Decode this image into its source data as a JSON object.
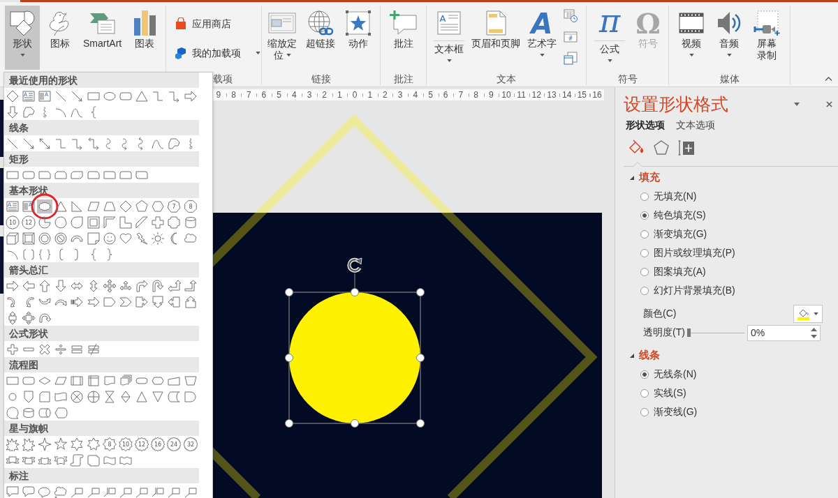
{
  "ribbon": {
    "groups": [
      {
        "buttons": [
          {
            "label": "形状",
            "kind": "large",
            "dropdown": true,
            "expanded": true,
            "disabled": false
          },
          {
            "label": "图标",
            "kind": "large",
            "dropdown": false,
            "expanded": false,
            "disabled": false
          },
          {
            "label": "SmartArt",
            "kind": "large",
            "dropdown": false,
            "expanded": false,
            "disabled": false
          },
          {
            "label": "图表",
            "kind": "large",
            "dropdown": false,
            "expanded": false,
            "disabled": false
          }
        ]
      },
      {
        "label": "载项",
        "buttons": [
          {
            "label": "应用商店",
            "kind": "row",
            "dropdown": false,
            "expanded": false,
            "disabled": false
          },
          {
            "label": "我的加载项",
            "kind": "row",
            "dropdown": true,
            "expanded": false,
            "disabled": false
          }
        ]
      },
      {
        "label": "链接",
        "buttons": [
          {
            "label": "缩放定位",
            "kind": "tall",
            "dropdown": true,
            "expanded": false,
            "disabled": false
          },
          {
            "label": "超链接",
            "kind": "large",
            "dropdown": false,
            "expanded": false,
            "disabled": false
          },
          {
            "label": "动作",
            "kind": "large",
            "dropdown": false,
            "expanded": false,
            "disabled": false
          }
        ]
      },
      {
        "label": "批注",
        "buttons": [
          {
            "label": "批注",
            "kind": "large",
            "dropdown": false,
            "expanded": false,
            "disabled": false
          }
        ]
      },
      {
        "label": "文本",
        "buttons": [
          {
            "label": "文本框",
            "kind": "split",
            "glyph": "A",
            "dropdown": true,
            "expanded": false,
            "disabled": false
          },
          {
            "label": "页眉和页脚",
            "kind": "large",
            "dropdown": false,
            "expanded": false,
            "disabled": false
          },
          {
            "label": "艺术字",
            "kind": "large",
            "glyph": "A",
            "dropdown": true,
            "expanded": false,
            "disabled": false
          },
          {
            "kind": "small",
            "dropdown": false,
            "expanded": false,
            "disabled": false
          },
          {
            "kind": "small",
            "glyph": "#",
            "dropdown": false,
            "expanded": false,
            "disabled": false
          },
          {
            "kind": "small",
            "dropdown": false,
            "expanded": false,
            "disabled": false
          }
        ]
      },
      {
        "label": "符号",
        "buttons": [
          {
            "label": "公式",
            "kind": "split",
            "glyph": "π",
            "dropdown": true,
            "expanded": false,
            "disabled": false
          },
          {
            "label": "符号",
            "kind": "large",
            "glyph": "Ω",
            "dropdown": false,
            "expanded": false,
            "disabled": true
          }
        ]
      },
      {
        "label": "媒体",
        "buttons": [
          {
            "label": "视频",
            "kind": "large",
            "dropdown": true,
            "expanded": false,
            "disabled": false
          },
          {
            "label": "音频",
            "kind": "large",
            "dropdown": true,
            "expanded": false,
            "disabled": false
          },
          {
            "label": "屏幕录制",
            "kind": "tall",
            "dropdown": false,
            "expanded": false,
            "disabled": false
          }
        ]
      }
    ]
  },
  "shapes_gallery": {
    "sections": [
      {
        "heading": "最近使用的形状",
        "items": [
          {
            "kind": "diamond",
            "selected": false
          },
          {
            "kind": "textbox",
            "label": "A",
            "selected": false
          },
          {
            "kind": "vtextbox",
            "label": "A",
            "selected": false
          },
          {
            "kind": "line",
            "selected": false
          },
          {
            "kind": "linearrow",
            "selected": false
          },
          {
            "kind": "rect",
            "selected": false
          },
          {
            "kind": "oval",
            "selected": false
          },
          {
            "kind": "roundrect",
            "selected": false
          },
          {
            "kind": "triangle",
            "selected": false
          },
          {
            "kind": "elbow",
            "selected": false
          },
          {
            "kind": "elbowarrow",
            "selected": false
          },
          {
            "kind": "rightarrow",
            "selected": false
          },
          {
            "kind": "downarrow",
            "selected": false
          },
          {
            "kind": "freeform",
            "selected": false
          },
          {
            "kind": "scribble",
            "selected": false
          },
          {
            "kind": "arc",
            "selected": false
          },
          {
            "kind": "curve",
            "selected": false
          },
          {
            "kind": "leftbrace",
            "selected": false
          }
        ]
      },
      {
        "heading": "线条",
        "items": [
          {
            "kind": "line",
            "selected": false
          },
          {
            "kind": "linearrow",
            "selected": false
          },
          {
            "kind": "dblarrow",
            "selected": false
          },
          {
            "kind": "elbow",
            "selected": false
          },
          {
            "kind": "elbowarrow",
            "selected": false
          },
          {
            "kind": "elbowdbl",
            "selected": false
          },
          {
            "kind": "curved",
            "selected": false
          },
          {
            "kind": "curvedarrow",
            "selected": false
          },
          {
            "kind": "curveddbl",
            "selected": false
          },
          {
            "kind": "curve",
            "selected": false
          },
          {
            "kind": "freeform",
            "selected": false
          },
          {
            "kind": "scribble",
            "selected": false
          }
        ]
      },
      {
        "heading": "矩形",
        "items": [
          {
            "kind": "rect",
            "selected": false
          },
          {
            "kind": "roundrect",
            "selected": false
          },
          {
            "kind": "snip1",
            "selected": false
          },
          {
            "kind": "snip2same",
            "selected": false
          },
          {
            "kind": "snip2diag",
            "selected": false
          },
          {
            "kind": "snipround",
            "selected": false
          },
          {
            "kind": "round1",
            "selected": false
          },
          {
            "kind": "round2same",
            "selected": false
          },
          {
            "kind": "round2diag",
            "selected": false
          }
        ]
      },
      {
        "heading": "基本形状",
        "items": [
          {
            "kind": "textbox",
            "label": "A",
            "selected": false
          },
          {
            "kind": "vtextbox",
            "label": "A",
            "selected": false
          },
          {
            "kind": "oval",
            "selected": true
          },
          {
            "kind": "triangle",
            "selected": false
          },
          {
            "kind": "rtriangle",
            "selected": false
          },
          {
            "kind": "parallelogram",
            "selected": false
          },
          {
            "kind": "trapezoid",
            "selected": false
          },
          {
            "kind": "diamond",
            "selected": false
          },
          {
            "kind": "pentagon",
            "selected": false
          },
          {
            "kind": "hexagon",
            "selected": false
          },
          {
            "kind": "heptagon",
            "label": "7",
            "selected": false
          },
          {
            "kind": "octagon",
            "label": "8",
            "selected": false
          },
          {
            "kind": "decagon",
            "label": "10",
            "selected": false
          },
          {
            "kind": "dodecagon",
            "label": "12",
            "selected": false
          },
          {
            "kind": "pie",
            "selected": false
          },
          {
            "kind": "chord",
            "selected": false
          },
          {
            "kind": "teardrop",
            "selected": false
          },
          {
            "kind": "frame",
            "selected": false
          },
          {
            "kind": "halfframe",
            "selected": false
          },
          {
            "kind": "lshape",
            "selected": false
          },
          {
            "kind": "diagstripe",
            "selected": false
          },
          {
            "kind": "cross",
            "selected": false
          },
          {
            "kind": "plaque",
            "selected": false
          },
          {
            "kind": "can",
            "selected": false
          },
          {
            "kind": "cube",
            "selected": false
          },
          {
            "kind": "bevel",
            "selected": false
          },
          {
            "kind": "donut",
            "selected": false
          },
          {
            "kind": "nosymbol",
            "selected": false
          },
          {
            "kind": "blockarc",
            "selected": false
          },
          {
            "kind": "foldedcorner",
            "selected": false
          },
          {
            "kind": "smiley",
            "selected": false
          },
          {
            "kind": "heart",
            "selected": false
          },
          {
            "kind": "lightning",
            "selected": false
          },
          {
            "kind": "sun",
            "selected": false
          },
          {
            "kind": "moon",
            "selected": false
          },
          {
            "kind": "cloud",
            "selected": false
          },
          {
            "kind": "arc",
            "selected": false
          },
          {
            "kind": "bracketpair",
            "selected": false
          },
          {
            "kind": "bracepair",
            "selected": false
          },
          {
            "kind": "leftbracket",
            "selected": false
          },
          {
            "kind": "rightbracket",
            "selected": false
          },
          {
            "kind": "leftbrace",
            "selected": false
          },
          {
            "kind": "rightbrace",
            "selected": false
          }
        ]
      },
      {
        "heading": "箭头总汇",
        "items": [
          {
            "kind": "rightarrow",
            "selected": false
          },
          {
            "kind": "leftarrow",
            "selected": false
          },
          {
            "kind": "uparrow",
            "selected": false
          },
          {
            "kind": "downarrow",
            "selected": false
          },
          {
            "kind": "lrarrow",
            "selected": false
          },
          {
            "kind": "udarrow",
            "selected": false
          },
          {
            "kind": "quadarrow",
            "selected": false
          },
          {
            "kind": "lruparrow",
            "selected": false
          },
          {
            "kind": "bentarrow",
            "selected": false
          },
          {
            "kind": "uturn",
            "selected": false
          },
          {
            "kind": "leftuparrow",
            "selected": false
          },
          {
            "kind": "bentuparrow",
            "selected": false
          },
          {
            "kind": "curvedright",
            "selected": false
          },
          {
            "kind": "curvedleft",
            "selected": false
          },
          {
            "kind": "curvedup",
            "selected": false
          },
          {
            "kind": "curveddown",
            "selected": false
          },
          {
            "kind": "stripedright",
            "selected": false
          },
          {
            "kind": "notchedright",
            "selected": false
          },
          {
            "kind": "homeplate",
            "selected": false
          },
          {
            "kind": "chevron",
            "selected": false
          },
          {
            "kind": "rightcallout",
            "selected": false
          },
          {
            "kind": "downcallout",
            "selected": false
          },
          {
            "kind": "leftcallout",
            "selected": false
          },
          {
            "kind": "upcallout",
            "selected": false
          },
          {
            "kind": "udcallout",
            "selected": false
          },
          {
            "kind": "quadcallout",
            "selected": false
          },
          {
            "kind": "circulararrow",
            "selected": false
          }
        ]
      },
      {
        "heading": "公式形状",
        "items": [
          {
            "kind": "plus",
            "selected": false
          },
          {
            "kind": "minus",
            "selected": false
          },
          {
            "kind": "multiply",
            "selected": false
          },
          {
            "kind": "divide",
            "selected": false
          },
          {
            "kind": "equal",
            "selected": false
          },
          {
            "kind": "notequal",
            "selected": false
          }
        ]
      },
      {
        "heading": "流程图",
        "items": [
          {
            "kind": "process",
            "selected": false
          },
          {
            "kind": "alternate",
            "selected": false
          },
          {
            "kind": "decision",
            "selected": false
          },
          {
            "kind": "data",
            "selected": false
          },
          {
            "kind": "predefined",
            "selected": false
          },
          {
            "kind": "internal",
            "selected": false
          },
          {
            "kind": "document",
            "selected": false
          },
          {
            "kind": "multidoc",
            "selected": false
          },
          {
            "kind": "terminator",
            "selected": false
          },
          {
            "kind": "preparation",
            "selected": false
          },
          {
            "kind": "manualinput",
            "selected": false
          },
          {
            "kind": "manualop",
            "selected": false
          },
          {
            "kind": "connector",
            "selected": false
          },
          {
            "kind": "offpage",
            "selected": false
          },
          {
            "kind": "card",
            "selected": false
          },
          {
            "kind": "punchedtape",
            "selected": false
          },
          {
            "kind": "summing",
            "selected": false
          },
          {
            "kind": "orflow",
            "selected": false
          },
          {
            "kind": "collate",
            "selected": false
          },
          {
            "kind": "sort",
            "selected": false
          },
          {
            "kind": "extract",
            "selected": false
          },
          {
            "kind": "merge",
            "selected": false
          },
          {
            "kind": "storeddata",
            "selected": false
          },
          {
            "kind": "delay",
            "selected": false
          },
          {
            "kind": "sequential",
            "selected": false
          },
          {
            "kind": "magneticdisk",
            "selected": false
          },
          {
            "kind": "directaccess",
            "selected": false
          },
          {
            "kind": "display",
            "selected": false
          }
        ]
      },
      {
        "heading": "星与旗帜",
        "items": [
          {
            "kind": "explosion",
            "selected": false
          },
          {
            "kind": "burst",
            "selected": false
          },
          {
            "kind": "star4",
            "selected": false
          },
          {
            "kind": "star5",
            "selected": false
          },
          {
            "kind": "star6",
            "selected": false
          },
          {
            "kind": "star7",
            "selected": false
          },
          {
            "kind": "star8",
            "label": "8",
            "selected": false
          },
          {
            "kind": "star10",
            "label": "10",
            "selected": false
          },
          {
            "kind": "star12",
            "label": "12",
            "selected": false
          },
          {
            "kind": "star16",
            "label": "16",
            "selected": false
          },
          {
            "kind": "star24",
            "label": "24",
            "selected": false
          },
          {
            "kind": "star32",
            "label": "32",
            "selected": false
          },
          {
            "kind": "ribbonup",
            "selected": false
          },
          {
            "kind": "ribbondown",
            "selected": false
          },
          {
            "kind": "curvedribbonup",
            "selected": false
          },
          {
            "kind": "curvedribbondown",
            "selected": false
          },
          {
            "kind": "vscroll",
            "selected": false
          },
          {
            "kind": "hscroll",
            "selected": false
          },
          {
            "kind": "wave",
            "selected": false
          },
          {
            "kind": "doublewave",
            "selected": false
          }
        ]
      },
      {
        "heading": "标注",
        "items": [
          {
            "kind": "rectcallout",
            "selected": false
          },
          {
            "kind": "roundcallout",
            "selected": false
          },
          {
            "kind": "ovalcallout",
            "selected": false
          },
          {
            "kind": "cloudcallout",
            "selected": false
          },
          {
            "kind": "linecallout",
            "selected": false
          },
          {
            "kind": "linecallout",
            "selected": false
          },
          {
            "kind": "barcallout",
            "selected": false
          },
          {
            "kind": "linecallout",
            "selected": false
          },
          {
            "kind": "linecallout",
            "selected": false
          },
          {
            "kind": "barcallout",
            "selected": false
          },
          {
            "kind": "linecallout",
            "selected": false
          },
          {
            "kind": "linecallout",
            "selected": false
          }
        ]
      }
    ]
  },
  "ruler": {
    "marks": [
      "9",
      "8",
      "7",
      "6",
      "5",
      "4",
      "3",
      "2",
      "1",
      "0",
      "1",
      "2",
      "3",
      "4",
      "5",
      "6",
      "7",
      "8",
      "9",
      "10",
      "11",
      "12",
      "13",
      "14",
      "15",
      "16"
    ]
  },
  "slide": {
    "shapes": [
      {
        "kind": "diamond",
        "selected": false
      },
      {
        "kind": "circle",
        "selected": true
      }
    ]
  },
  "format_pane": {
    "title": "设置形状格式",
    "tabs": [
      {
        "label": "形状选项",
        "selected": true
      },
      {
        "label": "文本选项",
        "selected": false
      }
    ],
    "icon_tabs": [
      {
        "selected": true
      },
      {
        "selected": false
      },
      {
        "selected": false
      }
    ],
    "sections": [
      {
        "title": "填充",
        "expanded": true,
        "options": [
          {
            "label": "无填充(N)",
            "selected": false
          },
          {
            "label": "纯色填充(S)",
            "selected": true
          },
          {
            "label": "渐变填充(G)",
            "selected": false
          },
          {
            "label": "图片或纹理填充(P)",
            "selected": false
          },
          {
            "label": "图案填充(A)",
            "selected": false
          },
          {
            "label": "幻灯片背景填充(B)",
            "selected": false
          }
        ],
        "color": {
          "label": "颜色(C)",
          "color": "#fff200"
        },
        "transparency": {
          "label": "透明度(T)",
          "level": 0,
          "value": "0%"
        }
      },
      {
        "title": "线条",
        "expanded": true,
        "options": [
          {
            "label": "无线条(N)",
            "selected": true
          },
          {
            "label": "实线(S)",
            "selected": false
          },
          {
            "label": "渐变线(G)",
            "selected": false
          }
        ]
      }
    ]
  }
}
